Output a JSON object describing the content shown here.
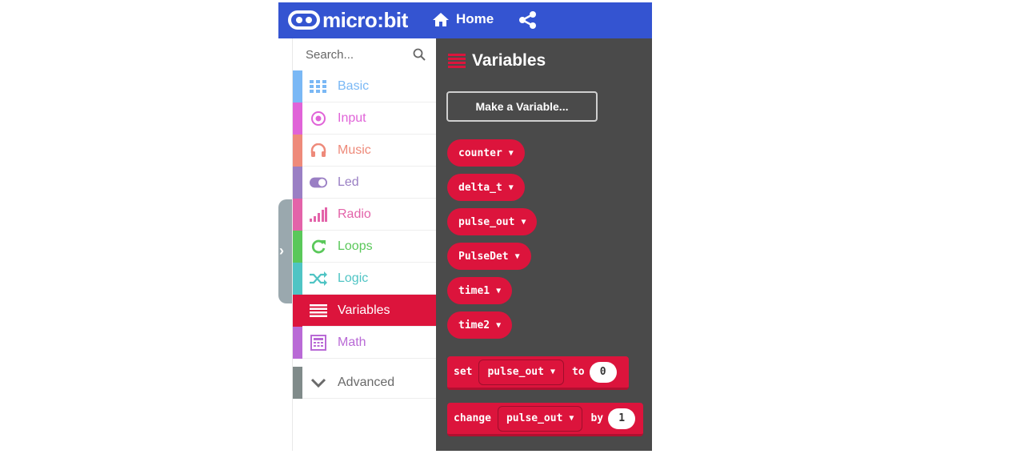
{
  "header": {
    "brand": "micro:bit",
    "home_label": "Home"
  },
  "toolbox": {
    "search_placeholder": "Search...",
    "categories": [
      {
        "label": "Basic",
        "color": "#7ab8f5",
        "icon": "grid-icon"
      },
      {
        "label": "Input",
        "color": "#e063d8",
        "icon": "target-icon"
      },
      {
        "label": "Music",
        "color": "#ee8a7a",
        "icon": "headphones-icon"
      },
      {
        "label": "Led",
        "color": "#9a7fc4",
        "icon": "toggle-icon"
      },
      {
        "label": "Radio",
        "color": "#e363a9",
        "icon": "signal-bars-icon"
      },
      {
        "label": "Loops",
        "color": "#5ac85a",
        "icon": "refresh-icon"
      },
      {
        "label": "Logic",
        "color": "#4fc4c4",
        "icon": "shuffle-icon"
      },
      {
        "label": "Variables",
        "color": "#dc143c",
        "icon": "list-icon",
        "selected": true
      },
      {
        "label": "Math",
        "color": "#b96ad6",
        "icon": "calculator-icon"
      },
      {
        "label": "Advanced",
        "color": "#808b8a",
        "icon": "chevron-down-icon"
      }
    ]
  },
  "flyout": {
    "title": "Variables",
    "make_variable_label": "Make a Variable...",
    "variables": [
      "counter",
      "delta_t",
      "pulse_out",
      "PulseDet",
      "time1",
      "time2"
    ],
    "set_block": {
      "keyword": "set",
      "variable": "pulse_out",
      "connector": "to",
      "value": "0"
    },
    "change_block": {
      "keyword": "change",
      "variable": "pulse_out",
      "connector": "by",
      "value": "1"
    }
  }
}
